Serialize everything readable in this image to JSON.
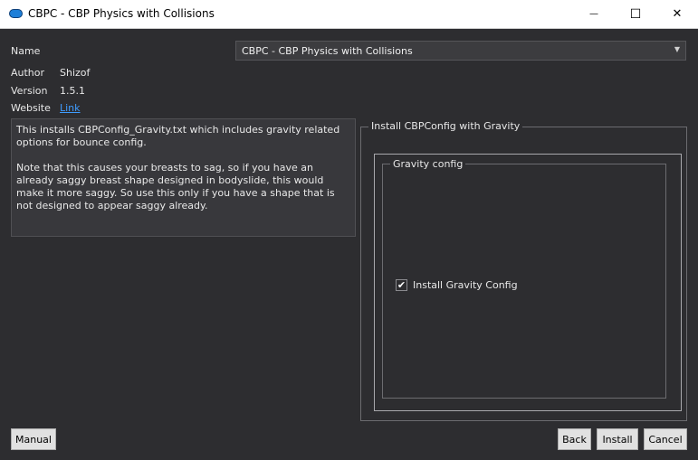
{
  "window": {
    "title": "CBPC - CBP Physics with Collisions",
    "minimize_glyph": "—",
    "maximize_glyph": "☐",
    "close_glyph": "✕"
  },
  "fields": {
    "name_label": "Name",
    "name_value": "CBPC - CBP Physics with Collisions",
    "author_label": "Author",
    "author_value": "Shizof",
    "version_label": "Version",
    "version_value": "1.5.1",
    "website_label": "Website",
    "website_link": "Link"
  },
  "description": {
    "paragraph1": "This installs CBPConfig_Gravity.txt which includes gravity related options for bounce config.",
    "paragraph2": "Note that this causes your breasts to sag, so if you have an already saggy breast shape designed in bodyslide, this would make it more saggy. So use this only if you have a shape that is not designed to appear saggy already."
  },
  "options": {
    "group_title": "Install CBPConfig with Gravity",
    "subgroup_title": "Gravity config",
    "checkbox_label": "Install Gravity Config",
    "checkbox_checked": true,
    "checkmark_glyph": "✔"
  },
  "buttons": {
    "manual": "Manual",
    "back": "Back",
    "install": "Install",
    "cancel": "Cancel"
  },
  "icons": {
    "app": "app-icon",
    "dropdown": "chevron-down-icon",
    "check": "checkmark-icon"
  }
}
